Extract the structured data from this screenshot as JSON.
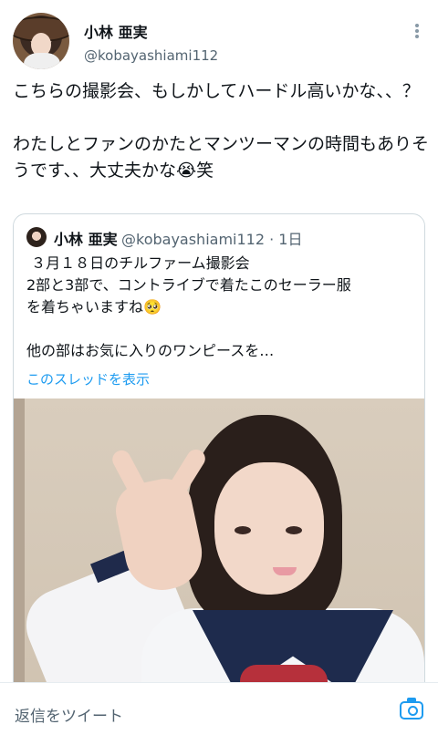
{
  "tweet": {
    "author_name": "小林 亜実",
    "author_handle": "@kobayashiami112",
    "text": "こちらの撮影会、もしかしてハードル高いかな、、？\n\nわたしとファンのかたとマンツーマンの時間もありそうです、、大丈夫かな😭笑"
  },
  "quoted_tweet": {
    "author_name": "小林 亜実",
    "author_handle_time": "@kobayashiami112 · 1日",
    "text": " ３月１８日のチルファーム撮影会\n2部と3部で、コントライブで着たこのセーラー服\nを着ちゃいますね🥺\n\n他の部はお気に入りのワンピースを…",
    "link": "このスレッドを表示"
  },
  "reply_bar": {
    "placeholder": "返信をツイート"
  },
  "icons": {
    "more": "more-vertical-icon",
    "camera": "camera-icon"
  },
  "colors": {
    "accent": "#1d9bf0",
    "secondary_text": "#536471",
    "border": "#cfd9de"
  }
}
